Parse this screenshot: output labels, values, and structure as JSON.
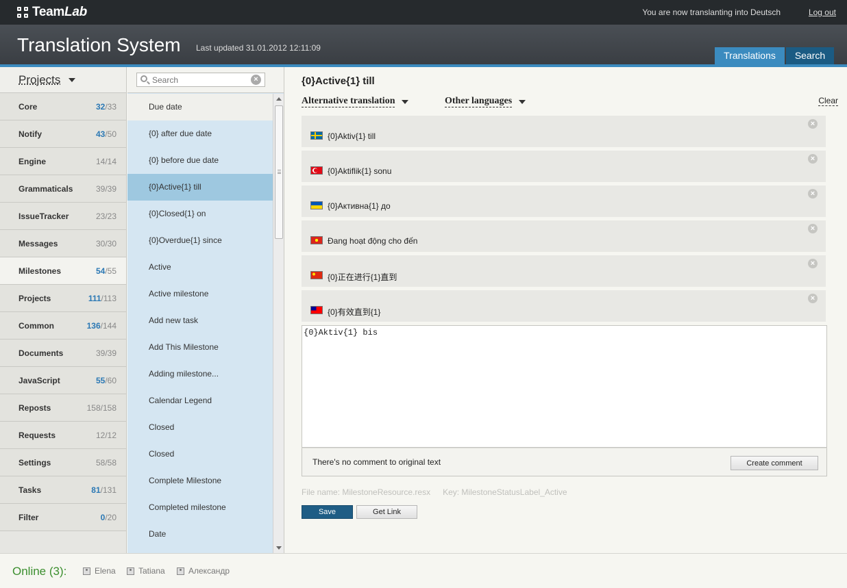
{
  "topbar": {
    "logo_team": "Team",
    "logo_lab": "Lab",
    "status": "You are now translanting into Deutsch",
    "logout": "Log out"
  },
  "header": {
    "title": "Translation System",
    "last_updated": "Last updated 31.01.2012 12:11:09",
    "tabs": [
      {
        "label": "Translations",
        "active": true
      },
      {
        "label": "Search",
        "active": false
      }
    ]
  },
  "projects": {
    "heading": "Projects",
    "items": [
      {
        "name": "Core",
        "done": "32",
        "total": "/33"
      },
      {
        "name": "Notify",
        "done": "43",
        "total": "/50"
      },
      {
        "name": "Engine",
        "done": "14",
        "total": "/14"
      },
      {
        "name": "Grammaticals",
        "done": "39",
        "total": "/39"
      },
      {
        "name": "IssueTracker",
        "done": "23",
        "total": "/23"
      },
      {
        "name": "Messages",
        "done": "30",
        "total": "/30"
      },
      {
        "name": "Milestones",
        "done": "54",
        "total": "/55"
      },
      {
        "name": "Projects",
        "done": "111",
        "total": "/113"
      },
      {
        "name": "Common",
        "done": "136",
        "total": "/144"
      },
      {
        "name": "Documents",
        "done": "39",
        "total": "/39"
      },
      {
        "name": "JavaScript",
        "done": "55",
        "total": "/60"
      },
      {
        "name": "Reposts",
        "done": "158",
        "total": "/158"
      },
      {
        "name": "Requests",
        "done": "12",
        "total": "/12"
      },
      {
        "name": "Settings",
        "done": "58",
        "total": "/58"
      },
      {
        "name": "Tasks",
        "done": "81",
        "total": "/131"
      },
      {
        "name": "Filter",
        "done": "0",
        "total": "/20"
      }
    ]
  },
  "keys": {
    "search_placeholder": "Search",
    "items": [
      "Due date",
      "{0} after due date",
      "{0} before due date",
      "{0}Active{1} till",
      "{0}Closed{1} on",
      "{0}Overdue{1} since",
      "Active",
      "Active milestone",
      "Add new task",
      "Add This Milestone",
      "Adding milestone...",
      "Calendar Legend",
      "Closed",
      "Closed",
      "Complete Milestone",
      "Completed milestone",
      "Date"
    ]
  },
  "main": {
    "key_title": "{0}Active{1} till",
    "alt_translation_label": "Alternative translation",
    "other_languages_label": "Other languages",
    "clear_label": "Clear",
    "alternatives": [
      {
        "flag": "sweden-flag-icon",
        "text": "{0}Aktiv{1} till"
      },
      {
        "flag": "turkey-flag-icon",
        "text": "{0}Aktiflik{1} sonu"
      },
      {
        "flag": "ukraine-flag-icon",
        "text": "{0}Активна{1} до"
      },
      {
        "flag": "vietnam-flag-icon",
        "text": "Đang hoạt động cho đến"
      },
      {
        "flag": "china-flag-icon",
        "text": "{0}正在进行{1}直到"
      },
      {
        "flag": "taiwan-flag-icon",
        "text": "{0}有效直到{1}"
      }
    ],
    "translation_value": "{0}Aktiv{1} bis",
    "comment_text": "There's no comment to original text",
    "create_comment": "Create comment",
    "file_name": "File name:  MilestoneResource.resx",
    "key_name": "Key: MilestoneStatusLabel_Active",
    "save": "Save",
    "get_link": "Get Link"
  },
  "footer": {
    "online": "Online (3):",
    "users": [
      "Elena",
      "Tatiana",
      "Александр"
    ]
  },
  "colors": {
    "accent": "#3b8bbf",
    "tab_active": "#3b8bbf",
    "tab_inactive": "#1b5b83",
    "selected_key": "#9ec8e0",
    "online_green": "#3b8e2e",
    "count_blue": "#2b78b4"
  }
}
